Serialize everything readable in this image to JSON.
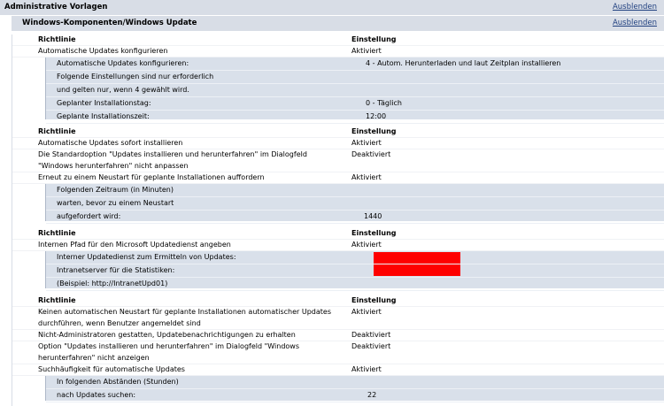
{
  "header": {
    "title": "Administrative Vorlagen",
    "hide_label": "Ausblenden"
  },
  "subheader": {
    "title": "Windows-Komponenten/Windows Update",
    "hide_label": "Ausblenden"
  },
  "columns": {
    "policy": "Richtlinie",
    "setting": "Einstellung"
  },
  "sections": [
    {
      "rows": [
        {
          "policy": "Automatische Updates konfigurieren",
          "setting": "Aktiviert"
        }
      ],
      "details": [
        {
          "label": "Automatische Updates konfigurieren:",
          "value": "4 - Autom. Herunterladen und laut Zeitplan installieren"
        },
        {
          "label": "Folgende Einstellungen sind nur erforderlich",
          "value": ""
        },
        {
          "label": "und gelten nur, wenn 4 gewählt wird.",
          "value": ""
        },
        {
          "label": "Geplanter Installationstag:",
          "value": "0 - Täglich"
        },
        {
          "label": "Geplante Installationszeit:",
          "value": "12:00"
        }
      ]
    },
    {
      "rows": [
        {
          "policy": "Automatische Updates sofort installieren",
          "setting": "Aktiviert"
        },
        {
          "policy": "Die Standardoption \"Updates installieren und herunterfahren\" im Dialogfeld \"Windows herunterfahren\" nicht anpassen",
          "setting": "Deaktiviert"
        },
        {
          "policy": "Erneut zu einem Neustart für geplante Installationen auffordern",
          "setting": "Aktiviert"
        }
      ],
      "details": [
        {
          "label": "Folgenden Zeitraum (in Minuten)",
          "value": ""
        },
        {
          "label": "warten, bevor zu einem Neustart",
          "value": ""
        },
        {
          "label": "aufgefordert wird:",
          "value": "1440"
        }
      ]
    },
    {
      "rows": [
        {
          "policy": "Internen Pfad für den Microsoft Updatedienst angeben",
          "setting": "Aktiviert"
        }
      ],
      "details": [
        {
          "label": "Interner Updatedienst zum Ermitteln von Updates:",
          "value": ""
        },
        {
          "label": "Intranetserver für die Statistiken:",
          "value": ""
        },
        {
          "label": "(Beispiel: http://IntranetUpd01)",
          "value": ""
        }
      ]
    },
    {
      "rows": [
        {
          "policy": "Keinen automatischen Neustart für geplante Installationen automatischer Updates durchführen, wenn Benutzer angemeldet sind",
          "setting": "Aktiviert"
        },
        {
          "policy": "Nicht-Administratoren gestatten, Updatebenachrichtigungen zu erhalten",
          "setting": "Deaktiviert"
        },
        {
          "policy": "Option \"Updates installieren und herunterfahren\" im Dialogfeld \"Windows herunterfahren\" nicht anzeigen",
          "setting": "Deaktiviert"
        },
        {
          "policy": "Suchhäufigkeit für automatische Updates",
          "setting": "Aktiviert"
        }
      ],
      "details": [
        {
          "label": "In folgenden Abständen (Stunden)",
          "value": ""
        },
        {
          "label": "nach Updates suchen:",
          "value": "22"
        }
      ]
    }
  ],
  "colors": {
    "header_bg": "#d8dde6",
    "detail_bg": "#d9e0ea",
    "link": "#1f3f7f",
    "redaction": "#fe0000"
  }
}
